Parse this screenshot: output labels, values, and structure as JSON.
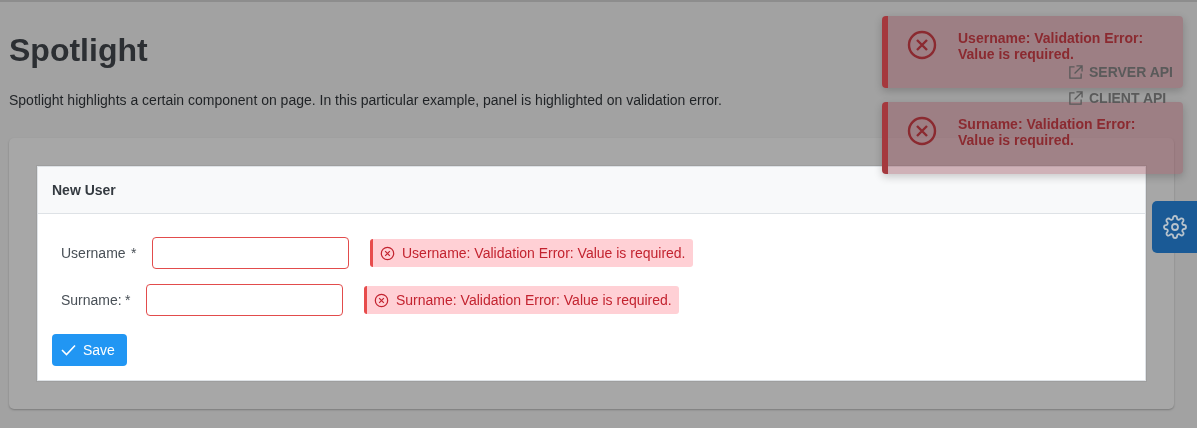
{
  "page": {
    "title": "Spotlight",
    "description": "Spotlight highlights a certain component on page. In this particular example, panel is highlighted on validation error.",
    "links": [
      {
        "label": "SERVER API"
      },
      {
        "label": "CLIENT API"
      }
    ]
  },
  "panel": {
    "header": "New User",
    "fields": [
      {
        "label": "Username",
        "required_mark": "*",
        "invalid": true,
        "message": "Username: Validation Error: Value is required."
      },
      {
        "label": "Surname:",
        "required_mark": "*",
        "invalid": true,
        "message": "Surname: Validation Error: Value is required."
      }
    ],
    "save_button": "Save"
  },
  "toasts": [
    {
      "text": "Username: Validation Error: Value is required."
    },
    {
      "text": "Surname: Validation Error: Value is required."
    }
  ]
}
